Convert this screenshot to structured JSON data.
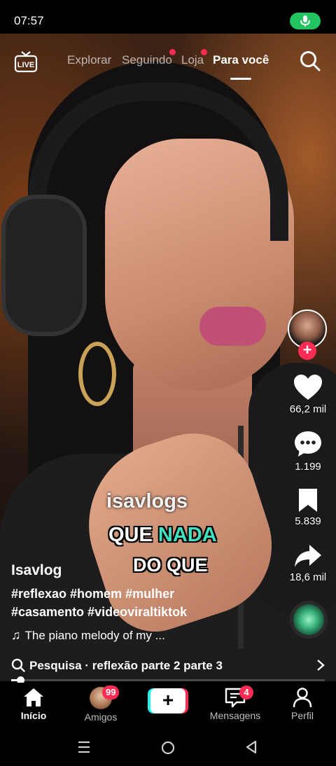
{
  "status_bar": {
    "time": "07:57"
  },
  "top_nav": {
    "live_label": "LIVE",
    "tabs": [
      {
        "label": "Explorar",
        "has_dot": false
      },
      {
        "label": "Seguindo",
        "has_dot": true
      },
      {
        "label": "Loja",
        "has_dot": true
      },
      {
        "label": "Para você",
        "has_dot": false,
        "active": true
      }
    ]
  },
  "video_captions": {
    "handle": "isavlogs",
    "line1_prefix": "QUE ",
    "line1_highlight": "NADA",
    "line2": "DO QUE"
  },
  "rail": {
    "likes": "66,2 mil",
    "comments": "1.199",
    "saves": "5.839",
    "shares": "18,6 mil"
  },
  "post": {
    "author": "Isavlog",
    "hashtags_line1": "#reflexao #homem #mulher",
    "hashtags_line2": "#casamento #videoviraltiktok",
    "music": "The piano melody of my ..."
  },
  "search_strip": {
    "label": "Pesquisa · reflexão parte 2 parte 3",
    "progress": 0.03
  },
  "bottom_nav": {
    "home": "Início",
    "friends": "Amigos",
    "friends_badge": "99",
    "messages": "Mensagens",
    "messages_badge": "4",
    "profile": "Perfil"
  },
  "colors": {
    "accent_red": "#fe2c55",
    "accent_cyan": "#25f4ee",
    "caption_highlight": "#40e0c0",
    "mic_green": "#21c45f"
  }
}
